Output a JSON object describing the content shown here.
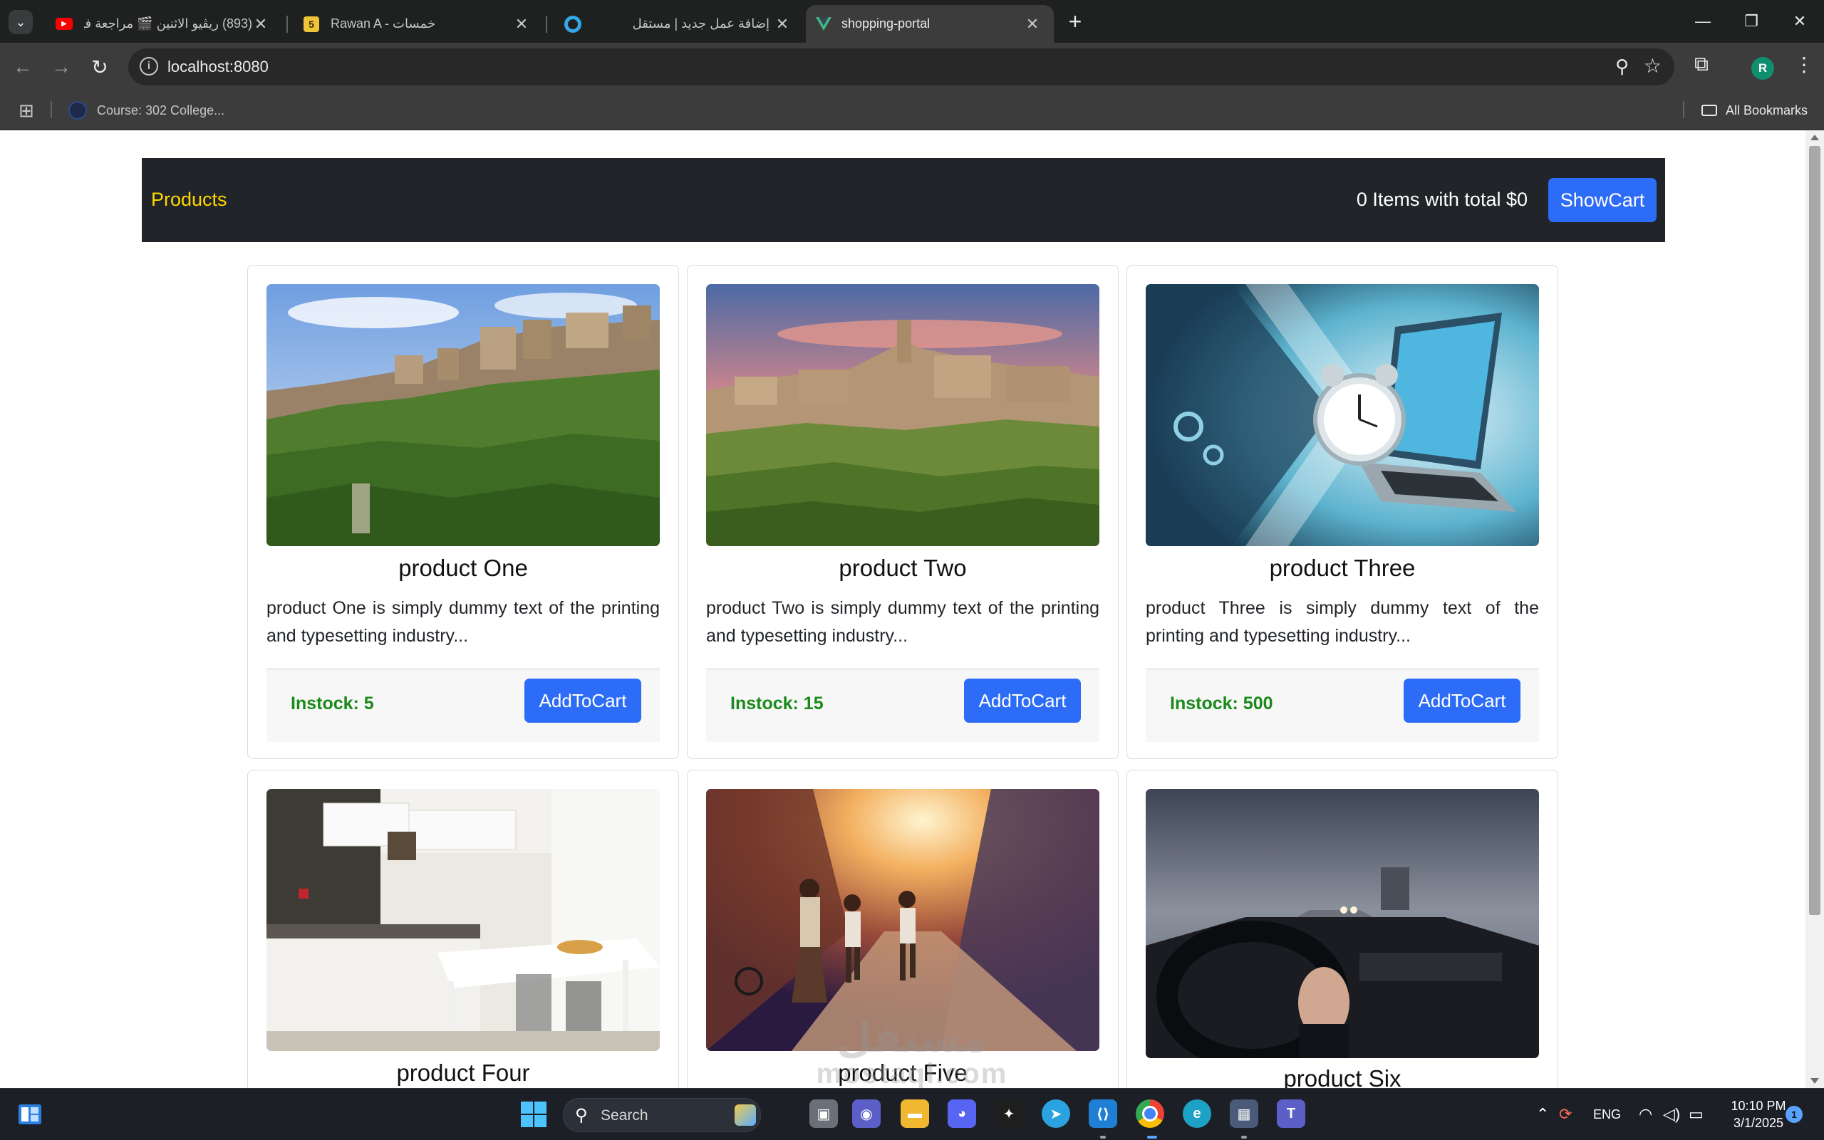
{
  "browser": {
    "tabs": [
      {
        "title": "(893) ريڤيو الاثنين 🎬 مراجعة فيلـ",
        "favicon": "youtube-icon",
        "active": false
      },
      {
        "title": "Rawan A - خمسات",
        "favicon": "khamsat-icon",
        "active": false
      },
      {
        "title": "إضافة عمل جديد | مستقل",
        "favicon": "mostaql-icon",
        "active": false
      },
      {
        "title": "shopping-portal",
        "favicon": "vue-icon",
        "active": true
      }
    ],
    "url": "localhost:8080",
    "profile_initial": "R",
    "bookmarks": [
      {
        "label": "Course: 302 College..."
      }
    ],
    "all_bookmarks_label": "All Bookmarks"
  },
  "page": {
    "brand": "Products",
    "cart_count": "0",
    "cart_summary": "0 Items with total $0",
    "show_cart_label": "ShowCart",
    "add_button_label": "AddToCart",
    "products": [
      {
        "title": "product One",
        "description": "product One is simply dummy text of the printing and typesetting industry...",
        "stock": "Instock: 5",
        "image": "hilltop-town-green-valley"
      },
      {
        "title": "product Two",
        "description": "product Two is simply dummy text of the printing and typesetting industry...",
        "stock": "Instock: 15",
        "image": "hilltop-town-sunset"
      },
      {
        "title": "product Three",
        "description": "product Three is simply dummy text of the printing and typesetting industry...",
        "stock": "Instock: 500",
        "image": "laptop-alarm-clock"
      },
      {
        "title": "product Four",
        "description": "",
        "stock": "",
        "image": "modern-white-kitchen"
      },
      {
        "title": "product Five",
        "description": "",
        "stock": "",
        "image": "children-running-sunset-street"
      },
      {
        "title": "product Six",
        "description": "",
        "stock": "",
        "image": "car-dashboard-foggy-road"
      }
    ],
    "watermark": {
      "arabic": "مستقل",
      "latin": "mostaql.com"
    }
  },
  "taskbar": {
    "search_label": "Search",
    "language": "ENG",
    "time": "10:10 PM",
    "date": "3/1/2025",
    "notification_count": "1"
  },
  "colors": {
    "navbar_bg": "#212529",
    "brand": "#ffd700",
    "primary_button": "#2d6cf6",
    "stock_text": "#1a8a1a"
  }
}
